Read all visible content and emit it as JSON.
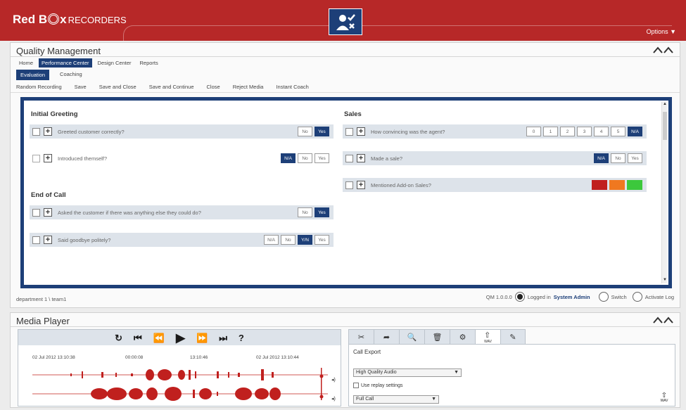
{
  "header": {
    "logo_main": "Red B",
    "logo_after": "x",
    "logo_sub": "RECORDERS",
    "options_label": "Options ▼",
    "brand_color": "#b72828",
    "accent_color": "#1d3f78"
  },
  "qm": {
    "title": "Quality Management",
    "nav": [
      "Home",
      "Performance Center",
      "Design Center",
      "Reports"
    ],
    "subnav": [
      "Evaluation",
      "Coaching"
    ],
    "toolbar": [
      "Random Recording",
      "Save",
      "Save and Close",
      "Save and Continue",
      "Close",
      "Reject Media",
      "Instant Coach"
    ],
    "sections": {
      "initial_greeting": "Initial Greeting",
      "end_of_call": "End of Call",
      "sales": "Sales"
    },
    "questions": {
      "q1": {
        "text": "Greeted customer correctly?",
        "answers": [
          "No",
          "Yes"
        ],
        "selected": "Yes"
      },
      "q2": {
        "text": "Introduced themself?",
        "answers": [
          "N/A",
          "No",
          "Yes"
        ],
        "selected": "N/A"
      },
      "q3": {
        "text": "Asked the customer if there was anything else they could do?",
        "answers": [
          "No",
          "Yes"
        ],
        "selected": "Yes"
      },
      "q4": {
        "text": "Said goodbye politely?",
        "answers": [
          "N/A",
          "No",
          "Y/N",
          "Yes"
        ],
        "selected": "Y/N"
      },
      "q5": {
        "text": "How convincing was the agent?",
        "answers": [
          "0",
          "1",
          "2",
          "3",
          "4",
          "5",
          "N/A"
        ],
        "selected": "N/A"
      },
      "q6": {
        "text": "Made a sale?",
        "answers": [
          "N/A",
          "No",
          "Yes"
        ],
        "selected": "N/A"
      },
      "q7": {
        "text": "Mentioned Add-on Sales?",
        "swatches": [
          "#c0201e",
          "#f07820",
          "#3cc83c"
        ]
      }
    },
    "path": "department 1 \\ team1",
    "status": {
      "version": "QM 1.0.0.0",
      "logged_in_prefix": "Logged in",
      "user": "System Admin",
      "switch": "Switch",
      "activate_log": "Activate Log"
    }
  },
  "media_player": {
    "title": "Media Player",
    "controls": [
      "reload-icon",
      "skip-start-icon",
      "rewind-icon",
      "play-icon",
      "fast-forward-icon",
      "skip-end-icon",
      "help-icon"
    ],
    "control_glyphs": [
      "↻",
      "⏮",
      "⏪",
      "▶",
      "⏩",
      "⏭",
      "?"
    ],
    "timeline": {
      "start": "02 Jul 2012 13:10:38",
      "elapsed": "00:00:08",
      "mid": "13:10:46",
      "end": "02 Jul 2012 13:10:44"
    },
    "export": {
      "tabs": [
        "cut-icon",
        "forward-icon",
        "search-icon",
        "delete-icon",
        "assign-icon",
        "wav-icon",
        "edit-icon"
      ],
      "title": "Call Export",
      "quality_select": "High Quality Audio",
      "replay_settings": "Use replay settings",
      "range_select": "Full Call",
      "wav_label": "WAV"
    }
  }
}
